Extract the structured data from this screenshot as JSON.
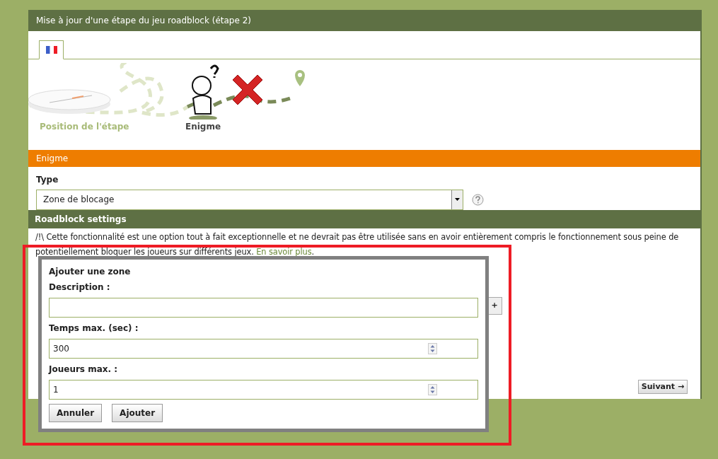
{
  "panel": {
    "title": "Mise à jour d'une étape du jeu roadblock (étape 2)"
  },
  "language_tabs": [
    {
      "selected": true
    }
  ],
  "steps": [
    {
      "label": "Position de l'étape",
      "current": false
    },
    {
      "label": "Enigme",
      "current": true
    }
  ],
  "enigme_section": {
    "title": "Enigme",
    "type_label": "Type",
    "type_value": "Zone de blocage"
  },
  "roadblock_section": {
    "title": "Roadblock settings",
    "notice": "/!\\ Cette fonctionnalité est une option tout à fait exceptionnelle et ne devrait pas être utilisée sans en avoir entièrement compris le fonctionnement sous peine de potentiellement bloquer les joueurs sur différents jeux.",
    "link": "En savoir plus",
    "notice_end": ".",
    "add_button": "+",
    "next_button": "Suivant →"
  },
  "dialog": {
    "title": "Ajouter une zone",
    "fields": [
      {
        "label": "Description :",
        "kind": "text"
      },
      {
        "label": "Temps max. (sec) :",
        "value": "300",
        "kind": "number"
      },
      {
        "label": "Joueurs max. :",
        "value": "1",
        "kind": "number"
      }
    ],
    "buttons": [
      "Annuler",
      "Ajouter"
    ]
  }
}
